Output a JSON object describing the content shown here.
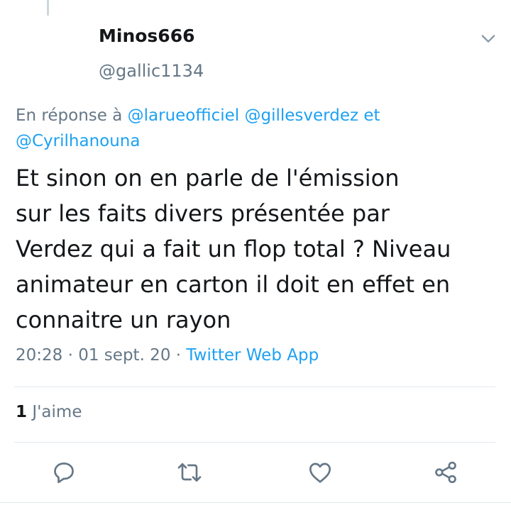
{
  "author": {
    "display_name": "Minos666",
    "handle": "@gallic1134"
  },
  "reply_context": {
    "prefix": "En réponse à",
    "mentions": [
      "@larueofficiel",
      "@gillesverdez"
    ],
    "joiner": "et",
    "last_mention": "@Cyrilhanouna"
  },
  "tweet": {
    "text": "Et sinon on en parle de l'émission\nsur les faits divers présentée par\nVerdez qui a fait un flop total ? Niveau\nanimateur en carton il doit en effet en\nconnaitre un rayon"
  },
  "meta": {
    "time": "20:28",
    "separator": "·",
    "date": "01 sept. 20",
    "source": "Twitter Web App"
  },
  "stats": {
    "likes_count": "1",
    "likes_label": "J'aime"
  },
  "icons": {
    "menu": "chevron-down-icon",
    "reply": "reply-icon",
    "retweet": "retweet-icon",
    "like": "heart-icon",
    "share": "share-icon"
  },
  "colors": {
    "accent": "#1da1f2",
    "secondary_text": "#657786",
    "primary_text": "#14171a",
    "divider": "#e1e8ed"
  }
}
